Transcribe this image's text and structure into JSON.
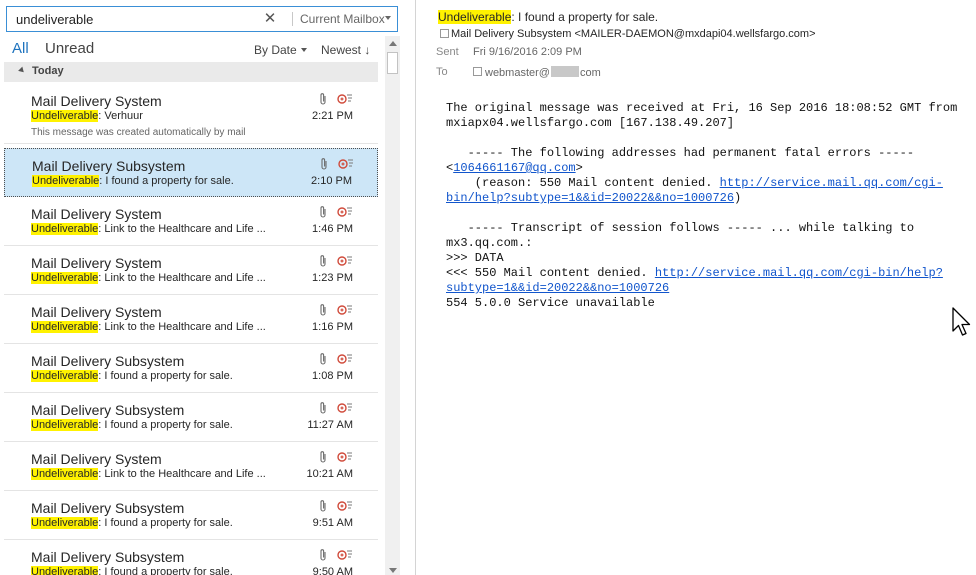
{
  "search": {
    "value": "undeliverable",
    "scope": "Current Mailbox"
  },
  "filters": {
    "all": "All",
    "unread": "Unread",
    "sort_by": "By Date",
    "sort_order": "Newest ↓"
  },
  "groups": {
    "today": "Today"
  },
  "highlight_term": "Undeliverable",
  "mails": [
    {
      "sender": "Mail Delivery System",
      "subject_rest": ": Verhuur",
      "preview": "This message was created automatically by mail",
      "time": "2:21 PM"
    },
    {
      "sender": "Mail Delivery Subsystem",
      "subject_rest": ": I found a property for sale.",
      "preview": "",
      "time": "2:10 PM",
      "selected": true
    },
    {
      "sender": "Mail Delivery System",
      "subject_rest": ": Link to the Healthcare and Life ...",
      "preview": "",
      "time": "1:46 PM"
    },
    {
      "sender": "Mail Delivery System",
      "subject_rest": ": Link to the Healthcare and Life ...",
      "preview": "",
      "time": "1:23 PM"
    },
    {
      "sender": "Mail Delivery System",
      "subject_rest": ": Link to the Healthcare and Life ...",
      "preview": "",
      "time": "1:16 PM"
    },
    {
      "sender": "Mail Delivery Subsystem",
      "subject_rest": ": I found a property for sale.",
      "preview": "",
      "time": "1:08 PM"
    },
    {
      "sender": "Mail Delivery Subsystem",
      "subject_rest": ": I found a property for sale.",
      "preview": "",
      "time": "11:27 AM"
    },
    {
      "sender": "Mail Delivery System",
      "subject_rest": ": Link to the Healthcare and Life ...",
      "preview": "",
      "time": "10:21 AM"
    },
    {
      "sender": "Mail Delivery Subsystem",
      "subject_rest": ": I found a property for sale.",
      "preview": "",
      "time": "9:51 AM"
    },
    {
      "sender": "Mail Delivery Subsystem",
      "subject_rest": ": I found a property for sale.",
      "preview": "",
      "time": "9:50 AM"
    }
  ],
  "reading": {
    "subject_highlight": "Undeliverable",
    "subject_rest": ": I found a property for sale.",
    "from": "Mail Delivery Subsystem <MAILER-DAEMON@mxdapi04.wellsfargo.com>",
    "sent_label": "Sent",
    "sent": "Fri 9/16/2016 2:09 PM",
    "to_label": "To",
    "to_user": "webmaster@",
    "to_domain": "com",
    "body": {
      "line1": "The original message was received at Fri, 16 Sep 2016 18:08:52 GMT from",
      "line2": "mxiapx04.wellsfargo.com [167.138.49.207]",
      "line3": "   ----- The following addresses had permanent fatal errors -----",
      "addr_open": "<",
      "addr": "1064661167@qq.com",
      "addr_close": ">",
      "reason_prefix": "    (reason: 550 Mail content denied. ",
      "link1_a": "http://service.mail.qq.com/cgi-",
      "link1_b": "bin/help?subtype=1&&id=20022&&no=1000726",
      "reason_suffix": ")",
      "line_transcript": "   ----- Transcript of session follows ----- ... while talking to",
      "line_host": "mx3.qq.com.:",
      "line_data": ">>> DATA",
      "denied_prefix": "<<< 550 Mail content denied. ",
      "link2_a": "http://service.mail.qq.com/cgi-bin/help?",
      "link2_b": "subtype=1&&id=20022&&no=1000726",
      "line_service": "554 5.0.0 Service unavailable"
    }
  },
  "icons": {
    "attachment": "paperclip-icon",
    "flag": "follow-up-flag-icon",
    "clear": "close-icon"
  },
  "colors": {
    "accent": "#1e73be",
    "highlight": "#fff200",
    "selected_row": "#cde6f7",
    "link": "#1155cc"
  }
}
